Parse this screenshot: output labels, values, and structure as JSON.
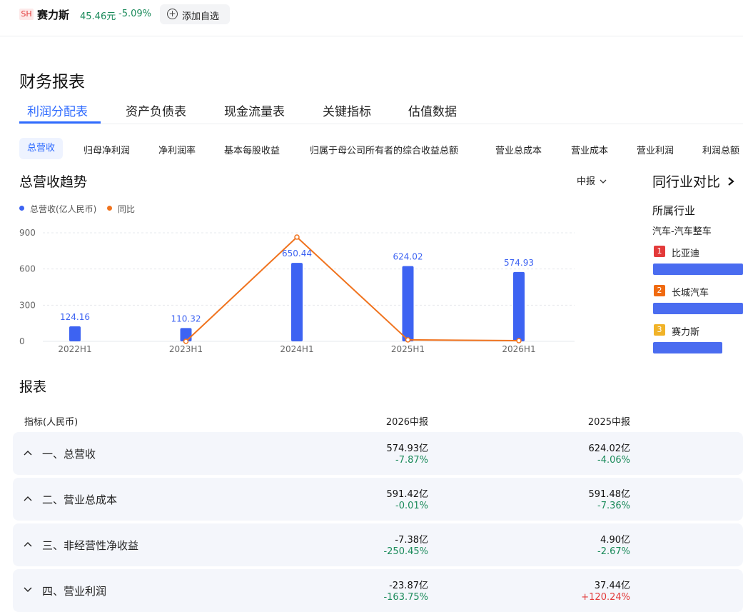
{
  "stock": {
    "market": "SH",
    "name": "赛力斯",
    "price": "45.46元",
    "change": "-5.09%",
    "watch_label": "添加自选"
  },
  "page": {
    "title": "财务报表"
  },
  "main_tabs": [
    "利润分配表",
    "资产负债表",
    "现金流量表",
    "关键指标",
    "估值数据"
  ],
  "sub_tabs": [
    "总营收",
    "归母净利润",
    "净利润率",
    "基本每股收益",
    "归属于母公司所有者的综合收益总额",
    "营业总成本",
    "营业成本",
    "营业利润",
    "利润总额"
  ],
  "trend": {
    "title": "总营收趋势",
    "period": "中报",
    "legend": [
      "总营收(亿人民币)",
      "同比"
    ]
  },
  "chart_data": {
    "type": "bar",
    "categories": [
      "2022H1",
      "2023H1",
      "2024H1",
      "2025H1",
      "2026H1"
    ],
    "series": [
      {
        "name": "总营收(亿人民币)",
        "type": "bar",
        "values": [
          124.16,
          110.32,
          650.44,
          624.02,
          574.93
        ],
        "labels": [
          "124.16",
          "110.32",
          "650.44",
          "624.02",
          "574.93"
        ]
      },
      {
        "name": "同比",
        "type": "line",
        "values": [
          null,
          -11.15,
          489.6,
          -4.06,
          -7.87
        ]
      }
    ],
    "y_ticks": [
      "900",
      "600",
      "300",
      "0"
    ],
    "ylim": [
      0,
      900
    ],
    "y2lim": [
      -11.15,
      489.6
    ],
    "colors": {
      "bar": "#3d63f2",
      "line": "#f0731e"
    },
    "grid": true
  },
  "peer": {
    "title": "同行业对比",
    "industry_label": "所属行业",
    "industry": "汽车-汽车整车",
    "companies": [
      {
        "rank": "1",
        "name": "比亚迪",
        "color": "#e33a3a",
        "bar": 1.0
      },
      {
        "rank": "2",
        "name": "长城汽车",
        "color": "#f06a10",
        "bar": 1.0
      },
      {
        "rank": "3",
        "name": "赛力斯",
        "color": "#f1b328",
        "bar": 0.77
      }
    ]
  },
  "report": {
    "title": "报表",
    "header": [
      "指标(人民币)",
      "2026中报",
      "2025中报"
    ],
    "rows": [
      {
        "label": "一、总营收",
        "expanded": true,
        "v1": "574.93亿",
        "p1": "-7.87%",
        "v2": "624.02亿",
        "p2": "-4.06%"
      },
      {
        "label": "二、营业总成本",
        "expanded": true,
        "v1": "591.42亿",
        "p1": "-0.01%",
        "v2": "591.48亿",
        "p2": "-7.36%"
      },
      {
        "label": "三、非经营性净收益",
        "expanded": true,
        "v1": "-7.38亿",
        "p1": "-250.45%",
        "v2": "4.90亿",
        "p2": "-2.67%"
      },
      {
        "label": "四、营业利润",
        "expanded": false,
        "v1": "-23.87亿",
        "p1": "-163.75%",
        "v2": "37.44亿",
        "p2": "+120.24%"
      }
    ]
  }
}
